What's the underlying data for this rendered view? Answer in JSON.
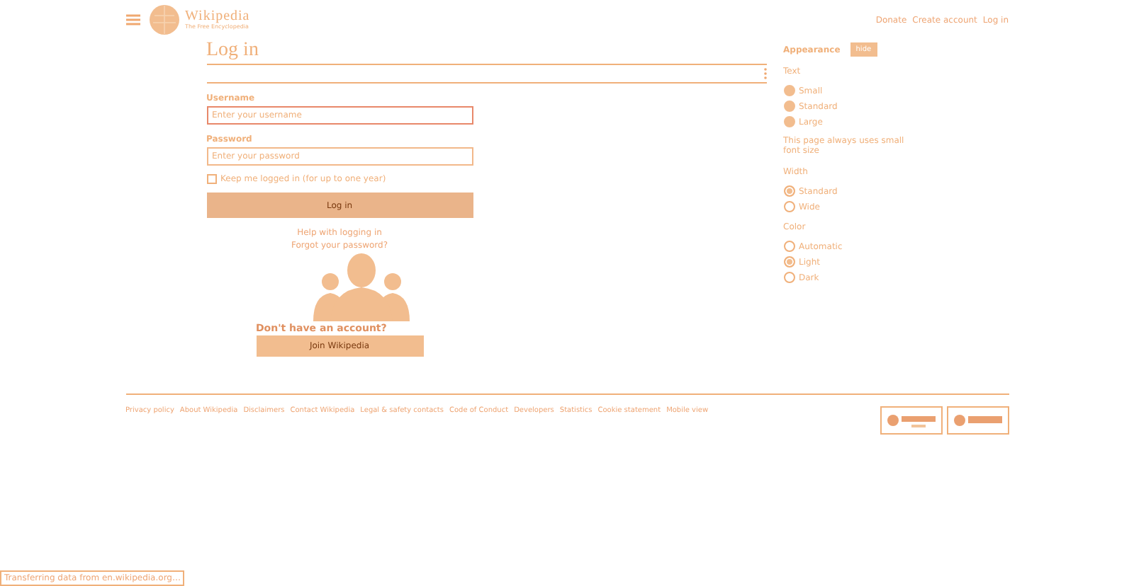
{
  "header": {
    "logo_title": "Wikipedia",
    "logo_tagline": "The Free Encyclopedia",
    "links": [
      "Donate",
      "Create account",
      "Log in"
    ]
  },
  "page_title": "Log in",
  "form": {
    "username_label": "Username",
    "username_placeholder": "Enter your username",
    "password_label": "Password",
    "password_placeholder": "Enter your password",
    "keep_logged_in": {
      "label": "Keep me logged in (for up to one year)",
      "checked": false
    },
    "submit": "Log in",
    "help_link": "Help with logging in",
    "forgot_link": "Forgot your password?",
    "no_account": "Don't have an account?",
    "join": "Join Wikipedia"
  },
  "appearance": {
    "title": "Appearance",
    "hide": "hide",
    "groups": [
      {
        "title": "Text",
        "note": "This page always uses small font size",
        "options": [
          {
            "label": "Small",
            "selected": false,
            "disabled": true
          },
          {
            "label": "Standard",
            "selected": false,
            "disabled": true
          },
          {
            "label": "Large",
            "selected": false,
            "disabled": true
          }
        ]
      },
      {
        "title": "Width",
        "options": [
          {
            "label": "Standard",
            "selected": true,
            "disabled": false
          },
          {
            "label": "Wide",
            "selected": false,
            "disabled": false
          }
        ]
      },
      {
        "title": "Color",
        "options": [
          {
            "label": "Automatic",
            "selected": false,
            "disabled": false
          },
          {
            "label": "Light",
            "selected": true,
            "disabled": false
          },
          {
            "label": "Dark",
            "selected": false,
            "disabled": false
          }
        ]
      }
    ]
  },
  "footer": {
    "links": [
      "Privacy policy",
      "About Wikipedia",
      "Disclaimers",
      "Contact Wikipedia",
      "Legal & safety contacts",
      "Code of Conduct",
      "Developers",
      "Statistics",
      "Cookie statement",
      "Mobile view"
    ]
  },
  "status_bar": "Transferring data from en.wikipedia.org…"
}
